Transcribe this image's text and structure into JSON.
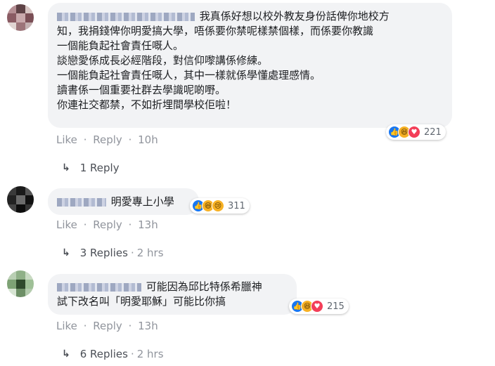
{
  "comments": [
    {
      "name_text": "",
      "text_lines": [
        "我真係好想以校外教友身份話俾你地校方",
        "知，我捐錢俾你明愛搞大學，唔係要你禁呢樣禁個樣，而係要你教識",
        "一個能負起社會責任嘅人。",
        "談戀愛係成長必經階段，對信仰嚟講係修練。",
        "一個能負起社會責任嘅人，其中一樣就係學懂處理感情。",
        "讀書係一個重要社群去學識呢啲嘢。",
        "你連社交都禁，不如折埋間學校佢啦！"
      ],
      "reactions": [
        "like",
        "haha",
        "love"
      ],
      "reaction_count": "221",
      "like": "Like",
      "reply": "Reply",
      "time": "10h",
      "replies_label": "1 Reply",
      "replies_time": ""
    },
    {
      "text_lines": [
        "明愛專上小學"
      ],
      "reactions": [
        "like",
        "haha",
        "sad"
      ],
      "reaction_count": "311",
      "like": "Like",
      "reply": "Reply",
      "time": "13h",
      "replies_label": "3 Replies",
      "replies_time": "2 hrs"
    },
    {
      "text_lines": [
        "可能因為邱比特係希臘神",
        "試下改名叫「明愛耶穌」可能比你搞"
      ],
      "reactions": [
        "like",
        "haha",
        "love"
      ],
      "reaction_count": "215",
      "like": "Like",
      "reply": "Reply",
      "time": "13h",
      "replies_label": "6 Replies",
      "replies_time": "2 hrs"
    }
  ],
  "separator": "·",
  "icons": {
    "reply_arrow": "reply-arrow-icon",
    "like": "like-icon",
    "haha": "haha-icon",
    "love": "love-icon",
    "sad": "sad-icon"
  },
  "colors": {
    "like": "#1877f2",
    "love": "#f33e58",
    "haha": "#f7b125",
    "meta": "#90949c",
    "bubble": "#f2f3f5"
  }
}
